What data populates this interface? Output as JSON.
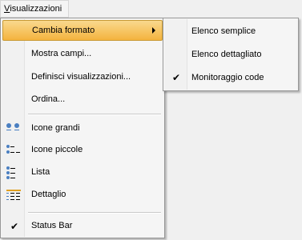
{
  "menubar": {
    "label_accel": "V",
    "label_rest": "isualizzazioni"
  },
  "menu": {
    "items": [
      {
        "label": "Cambia formato",
        "icon": "none",
        "submenu": true,
        "highlighted": true
      },
      {
        "label": "Mostra campi...",
        "icon": "none"
      },
      {
        "label": "Definisci visualizzazioni...",
        "icon": "none"
      },
      {
        "label": "Ordina...",
        "icon": "none"
      },
      {
        "label": "Icone grandi",
        "icon": "large-icons-icon"
      },
      {
        "label": "Icone piccole",
        "icon": "small-icons-icon"
      },
      {
        "label": "Lista",
        "icon": "list-view-icon"
      },
      {
        "label": "Dettaglio",
        "icon": "details-view-icon"
      },
      {
        "label": "Status Bar",
        "icon": "checkmark-icon",
        "checked": true
      }
    ]
  },
  "submenu": {
    "items": [
      {
        "label": "Elenco semplice"
      },
      {
        "label": "Elenco dettagliato"
      },
      {
        "label": "Monitoraggio code",
        "checked": true
      }
    ]
  },
  "glyphs": {
    "check": "✔"
  },
  "colors": {
    "highlight_top": "#f9d98e",
    "highlight_bottom": "#f4b33e",
    "icon_blue": "#4a7fc1"
  }
}
